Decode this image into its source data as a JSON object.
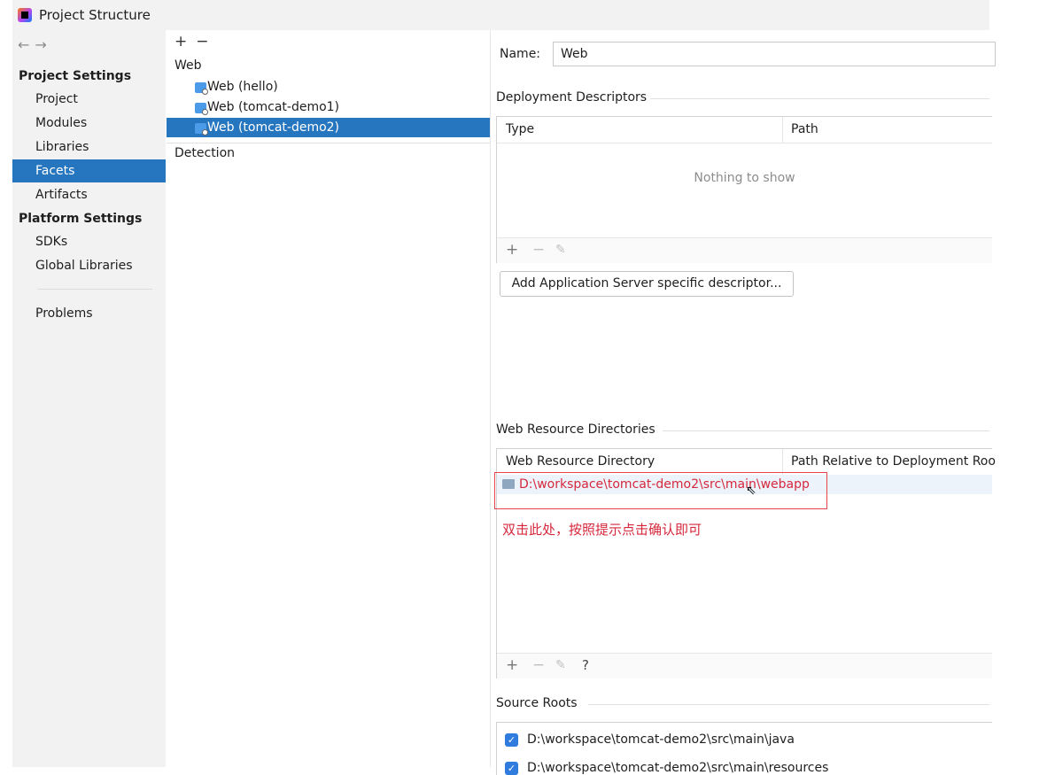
{
  "window": {
    "title": "Project Structure"
  },
  "nav": {
    "back": "←",
    "forward": "→"
  },
  "sidebar": {
    "project_settings_header": "Project Settings",
    "project_items": [
      "Project",
      "Modules",
      "Libraries",
      "Facets",
      "Artifacts"
    ],
    "selected": "Facets",
    "platform_settings_header": "Platform Settings",
    "platform_items": [
      "SDKs",
      "Global Libraries"
    ],
    "problems": "Problems"
  },
  "middle": {
    "add": "+",
    "remove": "−",
    "root": "Web",
    "facets": [
      "Web (hello)",
      "Web (tomcat-demo1)",
      "Web (tomcat-demo2)"
    ],
    "selected_facet": "Web (tomcat-demo2)",
    "detection": "Detection"
  },
  "details": {
    "name_label": "Name:",
    "name_value": "Web",
    "deployment": {
      "title": "Deployment Descriptors",
      "col_type": "Type",
      "col_path": "Path",
      "empty": "Nothing to show",
      "tools": [
        "+",
        "−",
        "✎"
      ],
      "add_button": "Add Application Server specific descriptor..."
    },
    "web_resources": {
      "title": "Web Resource Directories",
      "col_dir": "Web Resource Directory",
      "col_rel": "Path Relative to Deployment Roo",
      "row_path": "D:\\workspace\\tomcat-demo2\\src\\main\\webapp",
      "annotation": "双击此处，按照提示点击确认即可",
      "tools": [
        "+",
        "−",
        "✎",
        "?"
      ]
    },
    "source_roots": {
      "title": "Source Roots",
      "items": [
        "D:\\workspace\\tomcat-demo2\\src\\main\\java",
        "D:\\workspace\\tomcat-demo2\\src\\main\\resources"
      ]
    }
  },
  "colors": {
    "selection": "#2675bf",
    "annotation": "#d6283c",
    "sidebar_bg": "#f2f2f2"
  }
}
